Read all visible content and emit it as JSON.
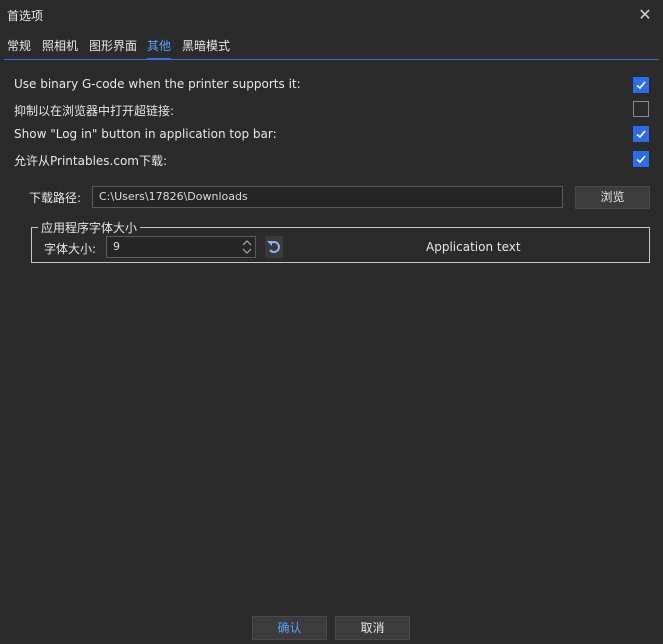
{
  "window": {
    "title": "首选项"
  },
  "tabs": [
    {
      "label": "常规"
    },
    {
      "label": "照相机"
    },
    {
      "label": "图形界面"
    },
    {
      "label": "其他"
    },
    {
      "label": "黑暗模式"
    }
  ],
  "active_tab": "其他",
  "options": [
    {
      "label": "Use binary G-code when the printer supports it:",
      "checked": true
    },
    {
      "label": "抑制以在浏览器中打开超链接:",
      "checked": false
    },
    {
      "label": "Show \"Log in\" button in application top bar:",
      "checked": true
    },
    {
      "label": "允许从Printables.com下载:",
      "checked": true
    }
  ],
  "download": {
    "label": "下载路径:",
    "value": "C:\\Users\\17826\\Downloads",
    "browse_label": "浏览"
  },
  "font_group": {
    "title": "应用程序字体大小",
    "size_label": "字体大小:",
    "size_value": "9",
    "sample_text": "Application text"
  },
  "footer": {
    "ok_label": "确认",
    "cancel_label": "取消"
  },
  "colors": {
    "accent": "#2e6be6",
    "background": "#2b2b2b",
    "active_tab_text": "#5b9cff"
  },
  "icons": {
    "close": "close-icon",
    "check": "check-icon",
    "reset": "reset-icon",
    "spin": "spin-arrows-icon"
  }
}
